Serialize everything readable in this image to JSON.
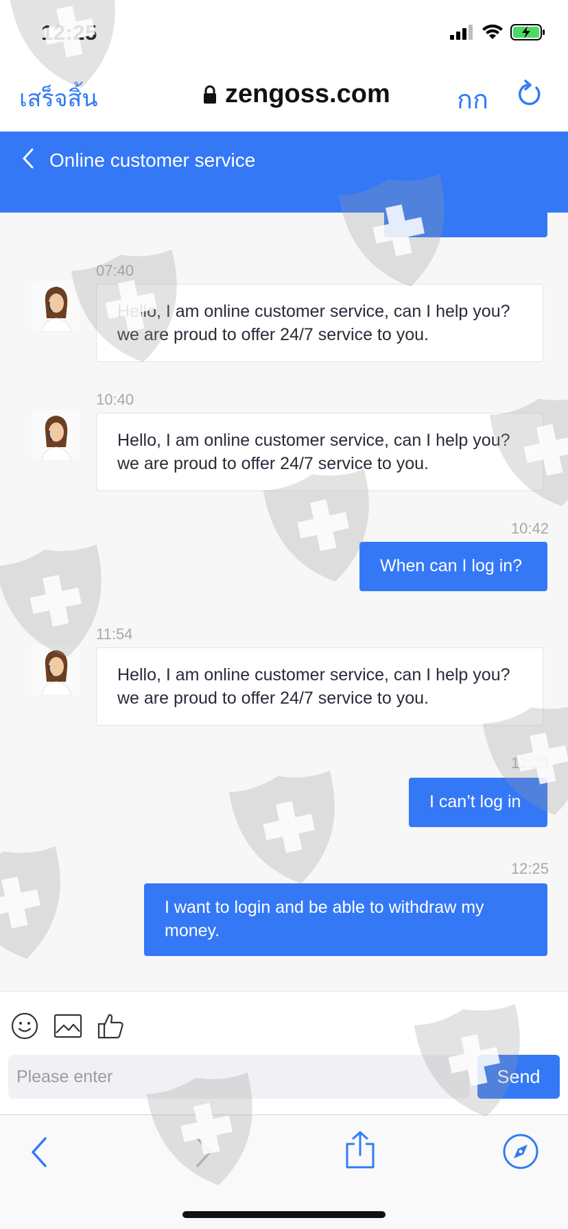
{
  "status_bar": {
    "time": "12:25"
  },
  "browser": {
    "done_label": "เสร็จสิ้น",
    "url": "zengoss.com",
    "reader_label": "กก"
  },
  "header": {
    "title": "Online customer service"
  },
  "messages": [
    {
      "side": "in",
      "time": "07:40",
      "text": "Hello, I am online customer service, can I help you? we are proud to offer 24/7 service to you."
    },
    {
      "side": "in",
      "time": "10:40",
      "text": "Hello, I am online customer service, can I help you? we are proud to offer 24/7 service to you."
    },
    {
      "side": "out",
      "time": "10:42",
      "text": "When can I log in?"
    },
    {
      "side": "in",
      "time": "11:54",
      "text": "Hello, I am online customer service, can I help you? we are proud to offer 24/7 service to you."
    },
    {
      "side": "out",
      "time": "12:23",
      "text": "I can’t log in"
    },
    {
      "side": "out",
      "time": "12:25",
      "text": "I want to login and be able to withdraw my money."
    }
  ],
  "composer": {
    "placeholder": "Please enter",
    "send_label": "Send"
  },
  "icons": {
    "emoji": "smiley-face-icon",
    "image": "image-icon",
    "like": "thumbs-up-icon",
    "back": "chevron-left-icon",
    "forward": "chevron-right-icon",
    "share": "share-icon",
    "safari": "compass-icon",
    "lock": "lock-icon",
    "reload": "reload-icon"
  },
  "colors": {
    "accent": "#3478f6",
    "ios_blue": "#2f7bf5",
    "bubble_in_bg": "#ffffff",
    "chat_bg": "#f7f7f7"
  }
}
